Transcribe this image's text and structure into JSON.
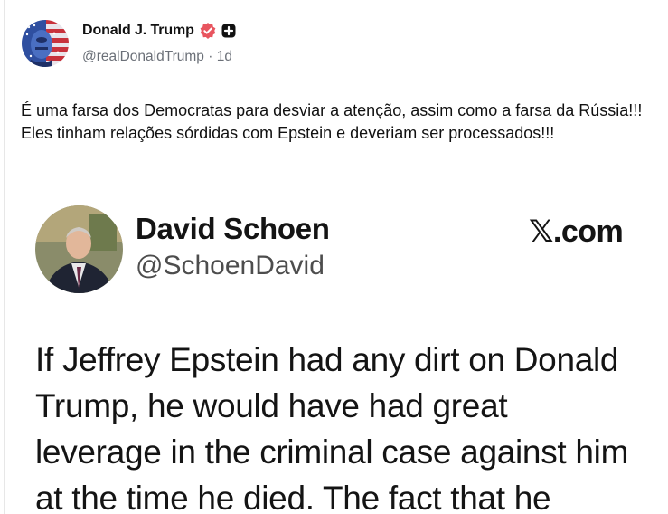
{
  "post": {
    "author_name": "Donald J. Trump",
    "handle": "@realDonaldTrump",
    "separator": "·",
    "time": "1d",
    "text": "É uma farsa dos Democratas para desviar a atenção, assim como a farsa da Rússia!!! Eles tinham relações sórdidas com Epstein e deveriam ser processados!!!",
    "avatar_icon": "flag-portrait-avatar",
    "verified_icon": "verified-badge-icon",
    "verified_color": "#e8555f",
    "plus_icon": "plus-badge-icon"
  },
  "embed": {
    "name": "David Schoen",
    "handle": "@SchoenDavid",
    "domain": "𝕏.com",
    "quote_lines": [
      "If Jeffrey Epstein had any dirt on Donald",
      "Trump, he would have had great",
      "leverage in the criminal case against him",
      "at the time he died.  The fact that he"
    ]
  }
}
